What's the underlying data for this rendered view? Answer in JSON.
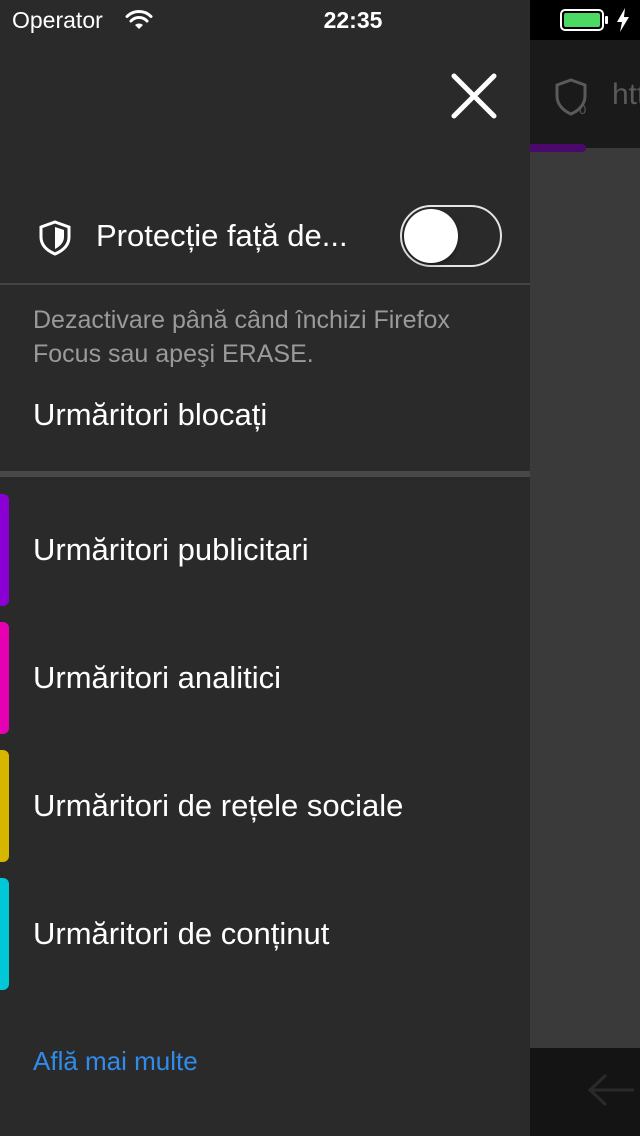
{
  "status_bar": {
    "carrier": "Operator",
    "time": "22:35",
    "battery_color": "#4cd964"
  },
  "background_browser": {
    "url_text": "htt",
    "tracker_count": "0"
  },
  "panel": {
    "toggle": {
      "label": "Protecție față de...",
      "enabled": false
    },
    "description": "Dezactivare până când închizi Firefox Focus sau apeşi ERASE.",
    "section_title": "Urmăritori blocați",
    "trackers": [
      {
        "label": "Urmăritori publicitari",
        "color": "#8a00d4"
      },
      {
        "label": "Urmăritori analitici",
        "color": "#e600b4"
      },
      {
        "label": "Urmăritori de rețele sociale",
        "color": "#d7b600"
      },
      {
        "label": "Urmăritori de conținut",
        "color": "#00c8d7"
      }
    ],
    "learn_more": "Află mai multe",
    "link_color": "#2f8ceb"
  }
}
